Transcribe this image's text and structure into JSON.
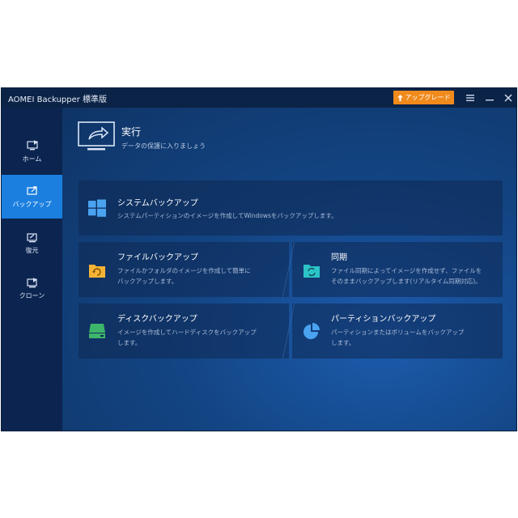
{
  "window": {
    "title": "AOMEI Backupper 標準版",
    "upgrade_label": "アップグレード",
    "menu_icon": "menu-icon",
    "minimize_icon": "minimize-icon",
    "close_icon": "close-icon"
  },
  "sidebar": {
    "items": [
      {
        "label": "ホーム",
        "icon": "home-icon",
        "active": false
      },
      {
        "label": "バックアップ",
        "icon": "backup-icon",
        "active": true
      },
      {
        "label": "復元",
        "icon": "restore-icon",
        "active": false
      },
      {
        "label": "クローン",
        "icon": "clone-icon",
        "active": false
      }
    ]
  },
  "header": {
    "title": "実行",
    "subtitle": "データの保護に入りましょう"
  },
  "cards": {
    "system": {
      "title": "システムバックアップ",
      "desc": "システムパーティションのイメージを作成してWindowsをバックアップします。"
    },
    "file": {
      "title": "ファイルバックアップ",
      "desc1": "ファイルかフォルダのイメージを作成して簡単に",
      "desc2": "バックアップします。"
    },
    "sync": {
      "title": "同期",
      "desc1": "ファイル同期によってイメージを作成せず、ファイルを",
      "desc2": "そのままバックアップします(リアルタイム同期対応)。"
    },
    "disk": {
      "title": "ディスクバックアップ",
      "desc1": "イメージを作成してハードディスクをバックアップ",
      "desc2": "します。"
    },
    "partition": {
      "title": "パーティションバックアップ",
      "desc1": "パーティションまたはボリュームをバックアップ",
      "desc2": "します。"
    }
  },
  "colors": {
    "accent": "#1b7fe0",
    "upgrade": "#f08a1c",
    "folder": "#f5b335",
    "sync": "#2cc3c8",
    "disk": "#3db56a",
    "pie": "#4aa3f0",
    "windows": "#4aa3f0"
  }
}
